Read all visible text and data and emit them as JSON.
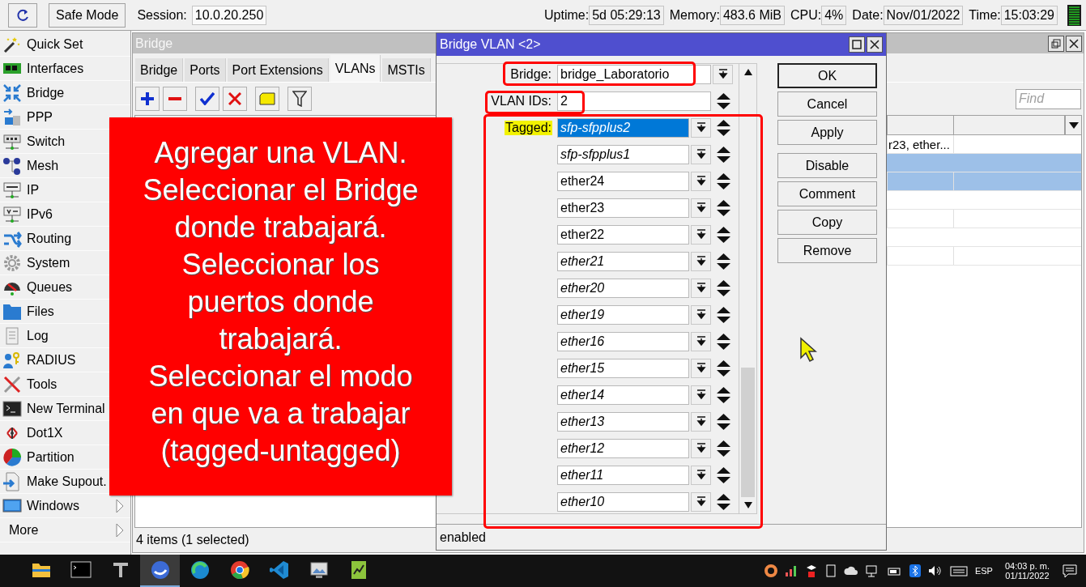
{
  "toolbar": {
    "safe_mode": "Safe Mode",
    "session_label": "Session:",
    "session": "10.0.20.250",
    "stats": [
      {
        "label": "Uptime:",
        "value": "5d 05:29:13"
      },
      {
        "label": "Memory:",
        "value": "483.6 MiB"
      },
      {
        "label": "CPU:",
        "value": "4%"
      },
      {
        "label": "Date:",
        "value": "Nov/01/2022"
      },
      {
        "label": "Time:",
        "value": "15:03:29"
      }
    ]
  },
  "sidebar": {
    "items": [
      {
        "label": "Quick Set",
        "kind": "module",
        "submenu": false
      },
      {
        "label": "Interfaces",
        "kind": "module",
        "submenu": false
      },
      {
        "label": "Bridge",
        "kind": "module",
        "submenu": false
      },
      {
        "label": "PPP",
        "kind": "module",
        "submenu": false
      },
      {
        "label": "Switch",
        "kind": "module",
        "submenu": false
      },
      {
        "label": "Mesh",
        "kind": "module",
        "submenu": false
      },
      {
        "label": "IP",
        "kind": "module",
        "submenu": false
      },
      {
        "label": "IPv6",
        "kind": "module",
        "submenu": false
      },
      {
        "label": "Routing",
        "kind": "module",
        "submenu": false
      },
      {
        "label": "System",
        "kind": "module",
        "submenu": false
      },
      {
        "label": "Queues",
        "kind": "module",
        "submenu": false
      },
      {
        "label": "Files",
        "kind": "module",
        "submenu": false
      },
      {
        "label": "Log",
        "kind": "module",
        "submenu": false
      },
      {
        "label": "RADIUS",
        "kind": "module",
        "submenu": false
      },
      {
        "label": "Tools",
        "kind": "module",
        "submenu": false
      },
      {
        "label": "New Terminal",
        "kind": "module",
        "submenu": false
      },
      {
        "label": "Dot1X",
        "kind": "module",
        "submenu": false
      },
      {
        "label": "Partition",
        "kind": "module",
        "submenu": false
      },
      {
        "label": "Make Supout.",
        "kind": "module",
        "submenu": false
      },
      {
        "label": "Windows",
        "kind": "module",
        "submenu": true
      },
      {
        "label": "More",
        "kind": "group",
        "submenu": true
      }
    ]
  },
  "bridge_window": {
    "title": "Bridge",
    "tabs": [
      {
        "label": "Bridge",
        "selected": false
      },
      {
        "label": "Ports",
        "selected": false
      },
      {
        "label": "Port Extensions",
        "selected": false
      },
      {
        "label": "VLANs",
        "selected": true
      },
      {
        "label": "MSTIs",
        "selected": false
      }
    ],
    "find": {
      "placeholder": "Find"
    },
    "table": {
      "rows": [
        {
          "kind": "entry",
          "selected": false,
          "cell": "r23, ether..."
        },
        {
          "kind": "comment",
          "selected": true
        },
        {
          "kind": "entry",
          "selected": true
        },
        {
          "kind": "comment",
          "selected": false
        },
        {
          "kind": "entry",
          "selected": false
        },
        {
          "kind": "comment",
          "selected": false
        },
        {
          "kind": "entry",
          "selected": false
        }
      ]
    },
    "status": "4 items (1 selected)"
  },
  "vlan_dialog": {
    "title": "Bridge VLAN <2>",
    "bridge": {
      "label": "Bridge:",
      "value": "bridge_Laboratorio"
    },
    "vlan_ids": {
      "label": "VLAN IDs:",
      "value": "2"
    },
    "tagged": {
      "label": "Tagged:",
      "highlighted": true,
      "ports": [
        {
          "value": "sfp-sfpplus2",
          "selected": true,
          "inactive": true
        },
        {
          "value": "sfp-sfpplus1",
          "selected": false,
          "inactive": true
        },
        {
          "value": "ether24",
          "selected": false,
          "inactive": false
        },
        {
          "value": "ether23",
          "selected": false,
          "inactive": false
        },
        {
          "value": "ether22",
          "selected": false,
          "inactive": false
        },
        {
          "value": "ether21",
          "selected": false,
          "inactive": true
        },
        {
          "value": "ether20",
          "selected": false,
          "inactive": true
        },
        {
          "value": "ether19",
          "selected": false,
          "inactive": true
        },
        {
          "value": "ether16",
          "selected": false,
          "inactive": true
        },
        {
          "value": "ether15",
          "selected": false,
          "inactive": true
        },
        {
          "value": "ether14",
          "selected": false,
          "inactive": true
        },
        {
          "value": "ether13",
          "selected": false,
          "inactive": true
        },
        {
          "value": "ether12",
          "selected": false,
          "inactive": true
        },
        {
          "value": "ether11",
          "selected": false,
          "inactive": true
        },
        {
          "value": "ether10",
          "selected": false,
          "inactive": true
        }
      ]
    },
    "button_groups": [
      [
        {
          "label": "OK",
          "default": true
        },
        {
          "label": "Cancel",
          "default": false
        },
        {
          "label": "Apply",
          "default": false
        }
      ],
      [
        {
          "label": "Disable",
          "default": false
        },
        {
          "label": "Comment",
          "default": false
        },
        {
          "label": "Copy",
          "default": false
        },
        {
          "label": "Remove",
          "default": false
        }
      ]
    ],
    "status": "enabled"
  },
  "callout": {
    "lines": [
      "Agregar una VLAN.",
      "Seleccionar el Bridge donde trabajará.",
      "Seleccionar los puertos donde trabajará.",
      "Seleccionar el modo en que va a trabajar (tagged-untagged)"
    ]
  },
  "taskbar": {
    "apps": [
      {
        "selected": false
      },
      {
        "selected": false
      },
      {
        "selected": false
      },
      {
        "selected": true
      },
      {
        "selected": false
      },
      {
        "selected": false
      },
      {
        "selected": false
      },
      {
        "selected": false
      },
      {
        "selected": false
      }
    ],
    "language": "ESP",
    "time": "04:03 p. m.",
    "date": "01/11/2022"
  }
}
